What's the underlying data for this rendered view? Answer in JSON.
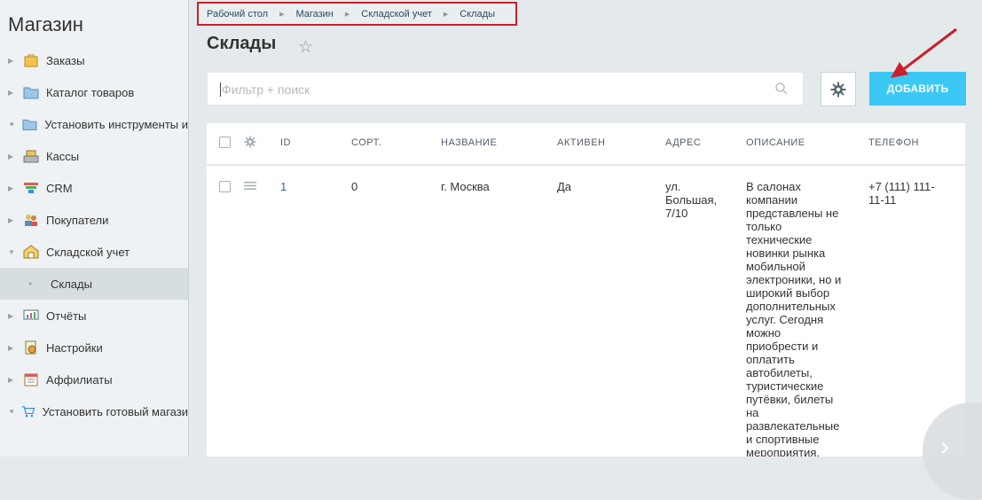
{
  "sidebar": {
    "title": "Магазин",
    "items": [
      {
        "label": "Заказы",
        "icon": "shopping-bag-icon"
      },
      {
        "label": "Каталог товаров",
        "icon": "folder-icon"
      },
      {
        "label": "Установить инструменты и",
        "icon": "folder-icon"
      },
      {
        "label": "Кассы",
        "icon": "cash-register-icon"
      },
      {
        "label": "CRM",
        "icon": "crm-funnel-icon"
      },
      {
        "label": "Покупатели",
        "icon": "users-icon"
      },
      {
        "label": "Складской учет",
        "icon": "warehouse-icon"
      },
      {
        "label": "Склады",
        "icon": ""
      },
      {
        "label": "Отчёты",
        "icon": "reports-icon"
      },
      {
        "label": "Настройки",
        "icon": "settings-icon"
      },
      {
        "label": "Аффилиаты",
        "icon": "affiliates-icon"
      },
      {
        "label": "Установить готовый магази",
        "icon": "cart-icon"
      }
    ]
  },
  "breadcrumb": [
    "Рабочий стол",
    "Магазин",
    "Складской учет",
    "Склады"
  ],
  "page": {
    "title": "Склады"
  },
  "filter": {
    "placeholder": "Фильтр + поиск"
  },
  "toolbar": {
    "add_label": "ДОБАВИТЬ"
  },
  "table": {
    "columns": [
      "ID",
      "СОРТ.",
      "НАЗВАНИЕ",
      "АКТИВЕН",
      "АДРЕС",
      "ОПИСАНИЕ",
      "ТЕЛЕФОН"
    ],
    "rows": [
      {
        "id": "1",
        "sort": "0",
        "name": "г. Москва",
        "active": "Да",
        "address": "ул. Большая, 7/10",
        "description": "В салонах компании представлены не только технические новинки рынка мобильной электроники, но и широкий выбор дополнительных услуг. Сегодня можно приобрести и оплатить автобилеты, туристические путёвки, билеты на развлекательные и спортивные мероприятия,",
        "phone": "+7 (111) 111-11-11"
      }
    ]
  },
  "colors": {
    "accent": "#3bc8f5",
    "highlight": "#c8202a"
  }
}
